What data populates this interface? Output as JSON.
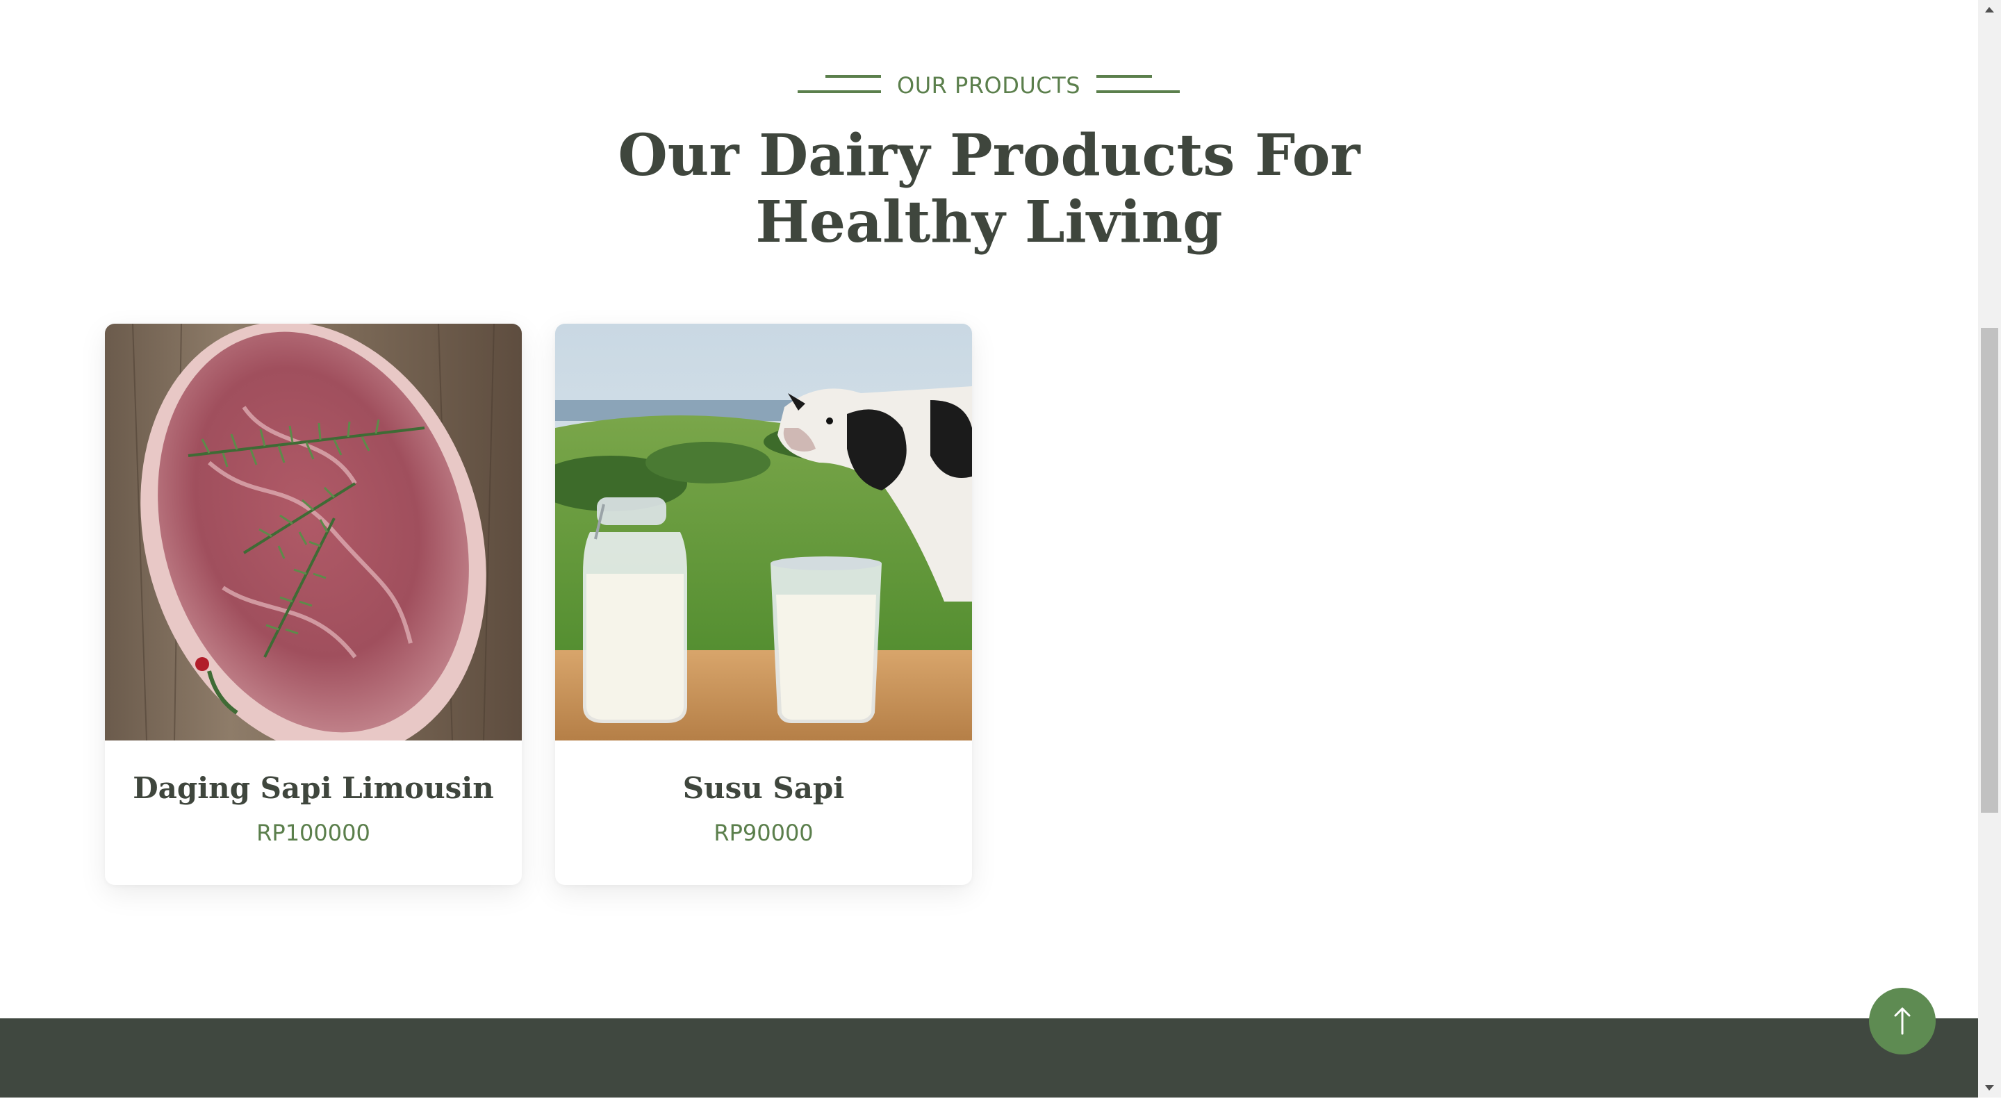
{
  "section": {
    "eyebrow": "OUR PRODUCTS",
    "title_line1": "Our Dairy Products For",
    "title_line2": "Healthy Living"
  },
  "products": [
    {
      "name": "Daging Sapi Limousin",
      "price": "RP100000",
      "image": "beef-steak-with-rosemary"
    },
    {
      "name": "Susu Sapi",
      "price": "RP90000",
      "image": "cow-with-milk-bottle-and-glass"
    }
  ],
  "colors": {
    "accent": "#5b7f4c",
    "heading": "#3f463d",
    "footer": "#404840",
    "button": "#5e8b52"
  },
  "icons": {
    "to_top": "arrow-up-icon"
  }
}
